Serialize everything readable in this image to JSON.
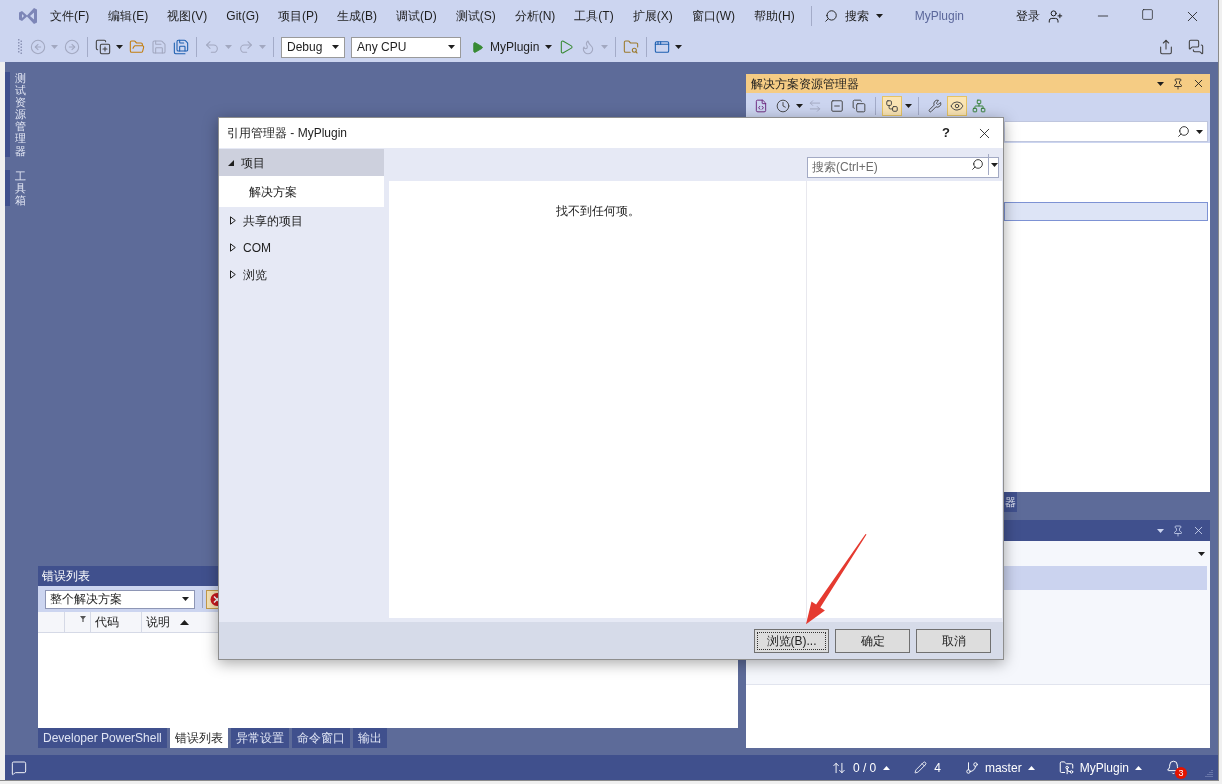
{
  "menu_bar": {
    "items": [
      "文件(F)",
      "编辑(E)",
      "视图(V)",
      "Git(G)",
      "项目(P)",
      "生成(B)",
      "调试(D)",
      "测试(S)",
      "分析(N)",
      "工具(T)",
      "扩展(X)",
      "窗口(W)",
      "帮助(H)"
    ],
    "search": "搜索",
    "title": "MyPlugin",
    "sign_in": "登录"
  },
  "toolbar": {
    "groups": [
      [
        {
          "kind": "back",
          "disabled": true,
          "menu": true
        },
        {
          "kind": "forward",
          "disabled": true
        }
      ],
      [
        {
          "kind": "new_project",
          "disabled": false,
          "menu": true
        },
        {
          "kind": "open",
          "disabled": false
        },
        {
          "kind": "save",
          "disabled": true
        },
        {
          "kind": "save_all",
          "disabled": false
        }
      ],
      [
        {
          "kind": "undo",
          "disabled": true,
          "menu": true
        },
        {
          "kind": "redo",
          "disabled": true,
          "menu": true
        }
      ],
      [
        {
          "kind": "configuration",
          "value": "Debug"
        },
        {
          "kind": "platform",
          "value": "Any CPU"
        },
        {
          "kind": "start",
          "label": "MyPlugin",
          "disabled": false,
          "menu": true
        },
        {
          "kind": "start_without_debugging",
          "disabled": false
        },
        {
          "kind": "hot_reload",
          "disabled": true,
          "menu": true
        }
      ],
      [
        {
          "kind": "find",
          "disabled": false
        }
      ],
      [
        {
          "kind": "layout",
          "disabled": false,
          "menu": true
        }
      ]
    ]
  },
  "side_tabs": [
    {
      "label": "测试资源管理器"
    },
    {
      "label": "工具箱"
    }
  ],
  "error_list": {
    "title": "错误列表",
    "scope": "整个解决方案",
    "errors_filter_on": true,
    "columns": [
      {
        "label": "代码",
        "sorted": false
      },
      {
        "label": "说明",
        "sorted": true
      }
    ]
  },
  "bottom_tabs": [
    {
      "label": "Developer PowerShell",
      "selected": false
    },
    {
      "label": "错误列表",
      "selected": true
    },
    {
      "label": "异常设置",
      "selected": false
    },
    {
      "label": "命令窗口",
      "selected": false
    },
    {
      "label": "输出",
      "selected": false
    }
  ],
  "solution_explorer": {
    "title": "解决方案资源管理器",
    "tools": [
      [
        {
          "kind": "solution",
          "on": false,
          "disabled": false
        },
        {
          "kind": "history",
          "on": false,
          "menu": true,
          "disabled": false
        },
        {
          "kind": "sync",
          "on": false,
          "disabled": true
        },
        {
          "kind": "collapse",
          "on": false,
          "disabled": false
        },
        {
          "kind": "copies",
          "on": false,
          "disabled": false
        }
      ],
      [
        {
          "kind": "show_all",
          "on": true,
          "menu": true,
          "disabled": false
        }
      ],
      [
        {
          "kind": "properties",
          "on": false,
          "disabled": false
        },
        {
          "kind": "preview",
          "on": true,
          "disabled": false
        },
        {
          "kind": "diagram",
          "on": false,
          "disabled": false
        }
      ]
    ]
  },
  "right_dock_tabs": [
    {
      "label": "器"
    }
  ],
  "status_bar": {
    "sync": "0 / 0",
    "changes": "4",
    "branch": "master",
    "repository": "MyPlugin",
    "notifications": "3"
  },
  "dialog": {
    "title": "引用管理器 - MyPlugin",
    "help": "?",
    "nav": [
      {
        "label": "项目",
        "selected": true,
        "expanded": true,
        "children": [
          {
            "label": "解决方案",
            "selected": true
          }
        ]
      },
      {
        "label": "共享的项目",
        "selected": false,
        "expanded": false
      },
      {
        "label": "COM",
        "selected": false,
        "expanded": false
      },
      {
        "label": "浏览",
        "selected": false,
        "expanded": false
      }
    ],
    "search": {
      "placeholder": "搜索(Ctrl+E)"
    },
    "empty_message": "找不到任何项。",
    "buttons": [
      {
        "label": "浏览(B)...",
        "focused": true
      },
      {
        "label": "确定",
        "focused": false
      },
      {
        "label": "取消",
        "focused": false
      }
    ]
  }
}
